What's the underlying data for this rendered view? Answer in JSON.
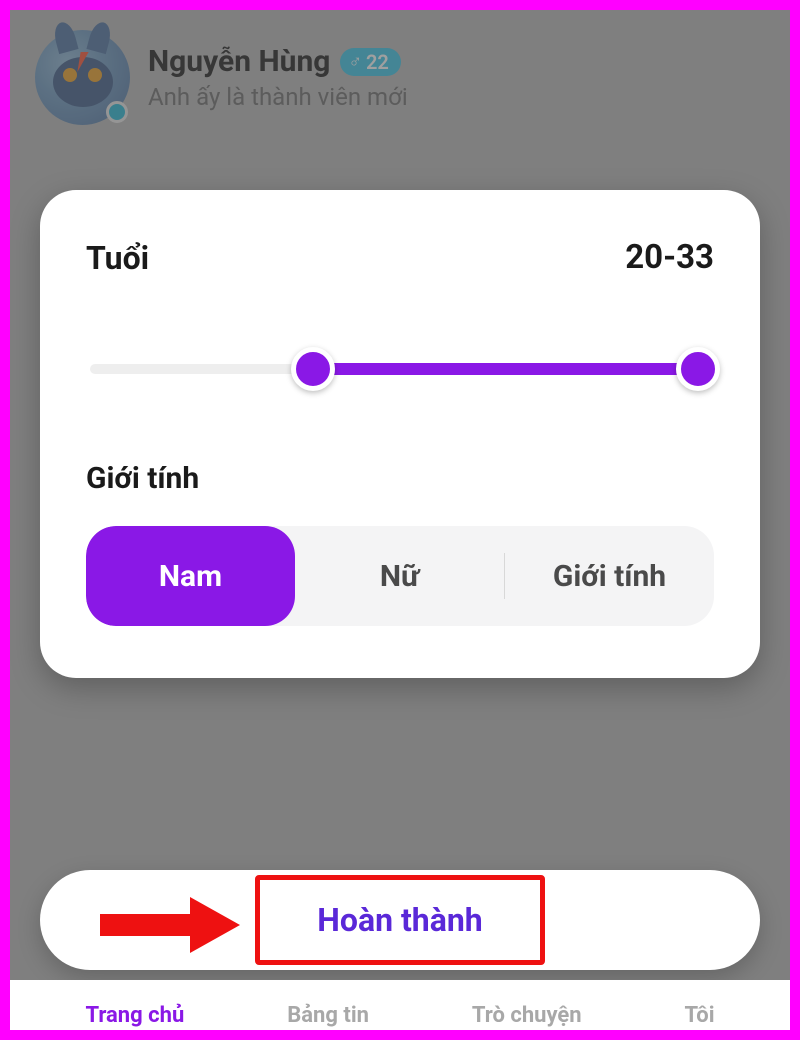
{
  "profile": {
    "name": "Nguyễn Hùng",
    "age_badge": "22",
    "gender_symbol": "♂",
    "subtitle": "Anh ấy là thành viên mới"
  },
  "filter": {
    "age_label": "Tuổi",
    "age_value": "20-33",
    "gender_label": "Giới tính",
    "options": {
      "male": "Nam",
      "female": "Nữ",
      "other": "Giới tính"
    }
  },
  "done_label": "Hoàn thành",
  "nav": {
    "home": "Trang chủ",
    "feed": "Bảng tin",
    "chat": "Trò chuyện",
    "me": "Tôi"
  }
}
